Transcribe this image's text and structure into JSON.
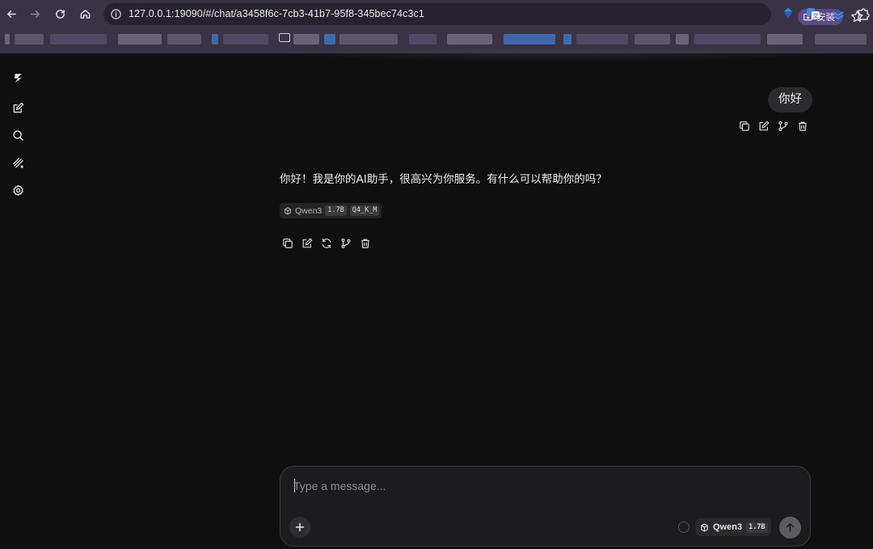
{
  "browser": {
    "url": "127.0.0.1:19090/#/chat/a3458f6c-7cb3-41b7-95f8-345bec74c3c1",
    "install_label": "安装"
  },
  "chat": {
    "user_message": "你好",
    "assistant_message": "你好！我是你的AI助手，很高兴为你服务。有什么可以帮助你的吗？",
    "assistant_model": {
      "name": "Qwen3",
      "size": "1.7B",
      "quant": "Q4_K_M"
    }
  },
  "composer": {
    "placeholder": "Type a message...",
    "model_name": "Qwen3",
    "model_size": "1.7B"
  },
  "icons": {
    "sidebar": [
      "logo-icon",
      "new-chat-icon",
      "search-icon",
      "models-icon",
      "settings-icon"
    ],
    "user_actions": [
      "copy-icon",
      "edit-icon",
      "branch-icon",
      "delete-icon"
    ],
    "assistant_actions": [
      "copy-icon",
      "edit-icon",
      "regenerate-icon",
      "branch-icon",
      "delete-icon"
    ]
  }
}
